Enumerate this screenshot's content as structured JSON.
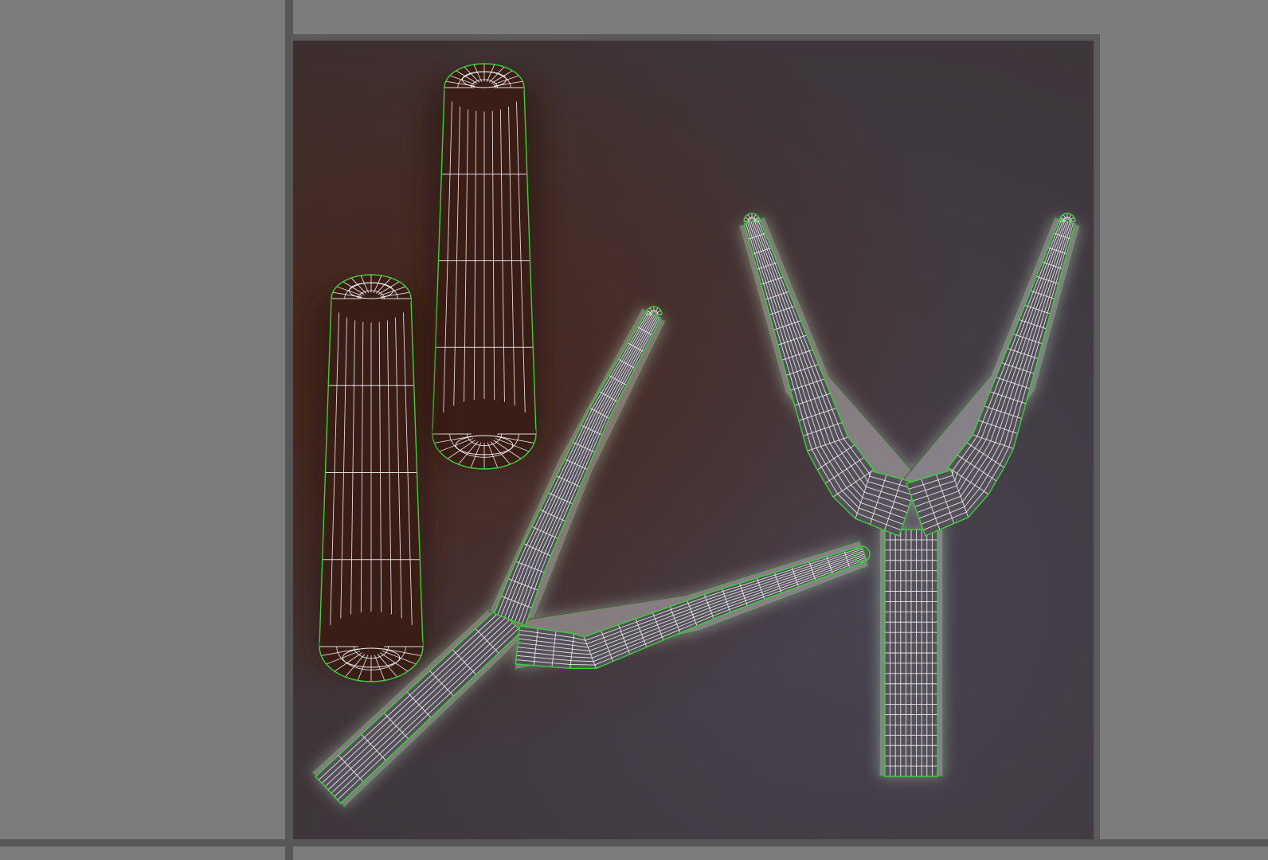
{
  "viewport": {
    "background_color": "#7c7c7c",
    "grid_color": "#575757"
  },
  "uv_tile": {
    "background_color": "#3f383e",
    "warm_shadow_color": "#4a2214"
  },
  "wireframe": {
    "edge_color": "#f2f2f2",
    "border_color": "#39d139",
    "selected_glow_color": "#ffffff"
  },
  "uv_shells": [
    {
      "name": "cylinder-shell-left",
      "selected": false
    },
    {
      "name": "cylinder-shell-right",
      "selected": false
    },
    {
      "name": "branch-shell-diagonal",
      "selected": true
    },
    {
      "name": "branch-shell-y",
      "selected": true
    }
  ]
}
